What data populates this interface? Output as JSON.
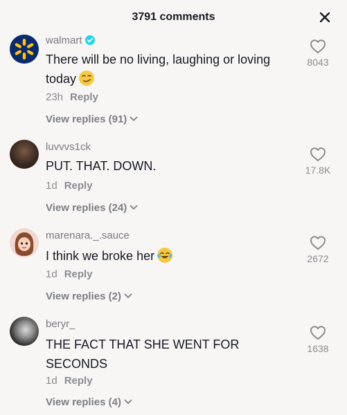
{
  "header": {
    "title": "3791 comments"
  },
  "comments": [
    {
      "username": "walmart",
      "verified": true,
      "text": "There will be no living, laughing or loving today",
      "emoji": "smirk-emoji",
      "time": "23h",
      "reply_label": "Reply",
      "view_replies": "View replies (91)",
      "likes": "8043"
    },
    {
      "username": "luvvvs1ck",
      "text": "PUT. THAT. DOWN.",
      "time": "1d",
      "reply_label": "Reply",
      "view_replies": "View replies (24)",
      "likes": "17.8K"
    },
    {
      "username": "marenara._.sauce",
      "text": "I think we broke her",
      "emoji": "tears-of-joy-emoji",
      "time": "1d",
      "reply_label": "Reply",
      "view_replies": "View replies (2)",
      "likes": "2672"
    },
    {
      "username": "beryr_",
      "text": "THE FACT THAT SHE WENT FOR SECONDS",
      "time": "1d",
      "reply_label": "Reply",
      "view_replies": "View replies (4)",
      "likes": "1638"
    }
  ],
  "colors": {
    "background": "#f7f6f5",
    "primary_text": "#161823",
    "secondary_text": "#8a8b91",
    "verified_blue": "#20d5ec",
    "walmart_blue": "#0a2b6b",
    "walmart_yellow": "#ffc220"
  }
}
